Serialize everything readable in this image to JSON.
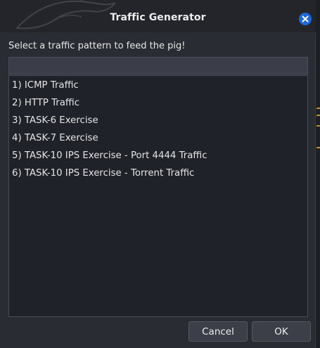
{
  "window": {
    "title": "Traffic Generator",
    "close_icon": "close-icon",
    "accent_color": "#1f67d8"
  },
  "dialog": {
    "prompt": "Select a traffic pattern to feed the pig!",
    "filter_value": "",
    "options": [
      "1) ICMP Traffic",
      "2) HTTP Traffic",
      "3) TASK-6 Exercise",
      "4) TASK-7 Exercise",
      "5) TASK-10 IPS Exercise - Port 4444 Traffic",
      "6) TASK-10 IPS Exercise - Torrent Traffic"
    ]
  },
  "buttons": {
    "cancel": "Cancel",
    "ok": "OK"
  }
}
